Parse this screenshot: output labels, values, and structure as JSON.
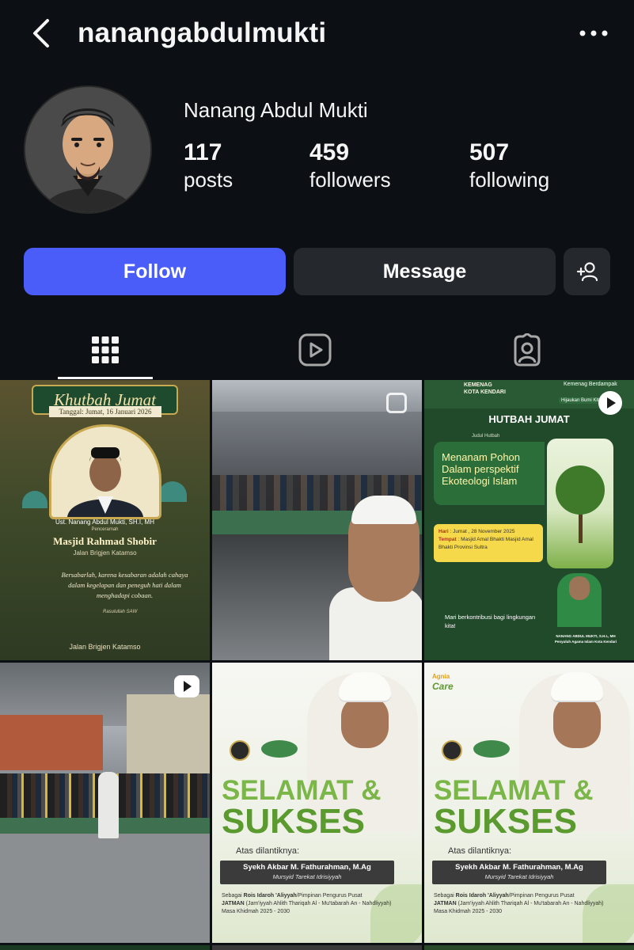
{
  "header": {
    "username": "nanangabdulmukti",
    "back_icon": "chevron-left-icon",
    "more_icon": "more-horizontal-icon"
  },
  "profile": {
    "display_name": "Nanang Abdul Mukti",
    "stats": {
      "posts": {
        "value": "117",
        "label": "posts"
      },
      "followers": {
        "value": "459",
        "label": "followers"
      },
      "following": {
        "value": "507",
        "label": "following"
      }
    }
  },
  "actions": {
    "follow_label": "Follow",
    "message_label": "Message",
    "add_user_icon": "add-user-icon"
  },
  "tabs": [
    {
      "name": "posts-grid",
      "icon": "grid-icon",
      "active": true
    },
    {
      "name": "reels",
      "icon": "reels-icon",
      "active": false
    },
    {
      "name": "tagged",
      "icon": "tagged-icon",
      "active": false
    }
  ],
  "posts": {
    "p1": {
      "banner": "Khutbah Jumat",
      "date": "Tanggal: Jumat, 16 Januari 2026",
      "speaker": "Ust. Nanang Abdul Mukti, SH.I, MH",
      "speaker_role": "Penceramah",
      "masjid": "Masjid Rahmad Shobir",
      "address": "Jalan Brigjen Katamso",
      "quote": "Bersabarlah, karena kesabaran adalah cahaya dalam kegelapan dan peneguh hati dalam menghadapi cobaan.",
      "quote_source": "Rasulullah SAW",
      "footer": "Jalan Brigjen Katamso"
    },
    "p3": {
      "kemenag": "KEMENAG\nKOTA KENDARI",
      "berdampak": "Kemenag Berdampak",
      "hijaukan": "Hijaukan Bumi Kita",
      "title": "HUTBAH JUMAT",
      "judul": "Judul Hutbah",
      "headline": "Menanam Pohon Dalam perspektif Ekoteologi Islam",
      "hari_label": "Hari",
      "hari": ": Jumat , 28 November 2025",
      "tempat_label": "Tempat",
      "tempat": ": Masjid Amal Bhakti Masjid Amal Bhakti Provinsi Sultra",
      "mari": "Mari berkontribusi bagi lingkungan kita!",
      "speaker_name": "NANANG ABDUL MUKTI, S.H.I., MH",
      "speaker_role": "Penyuluh Agama Islam Kota Kendari"
    },
    "p5": {
      "selamat": "SELAMAT &",
      "sukses": "SUKSES",
      "atas": "Atas dilantiknya:",
      "name": "Syekh Akbar M. Fathurahman, M.Ag",
      "role": "Mursyid Tarekat Idrisiyyah",
      "desc_pre": "Sebagai",
      "desc_bold": "Rois Idaroh 'Aliyyah",
      "desc_post": "/Pimpinan Pengurus Pusat",
      "jatman": "JATMAN",
      "jatman_full": "(Jam'iyyah Ahlith Thariqah Al - Mu'tabarah An - Nahdliyyah)",
      "masa": "Masa Khidmah 2025 - 2030"
    },
    "p6": {
      "brand": "Agnia",
      "brand_sub": "Care",
      "selamat": "SELAMAT &",
      "sukses": "SUKSES",
      "atas": "Atas dilantiknya:",
      "name": "Syekh Akbar M. Fathurahman, M.Ag",
      "role": "Mursyid Tarekat Idrisiyyah",
      "desc_pre": "Sebagai",
      "desc_bold": "Rois Idaroh 'Aliyyah",
      "desc_post": "/Pimpinan Pengurus Pusat",
      "jatman": "JATMAN",
      "jatman_full": "(Jam'iyyah Ahlith Thariqah Al - Mu'tabarah An - Nahdliyyah)",
      "masa": "Masa Khidmah 2025 - 2030"
    }
  },
  "colors": {
    "background": "#0c1014",
    "follow_button": "#4a5df9",
    "secondary_button": "#25292e",
    "text": "#f5f5f5"
  }
}
